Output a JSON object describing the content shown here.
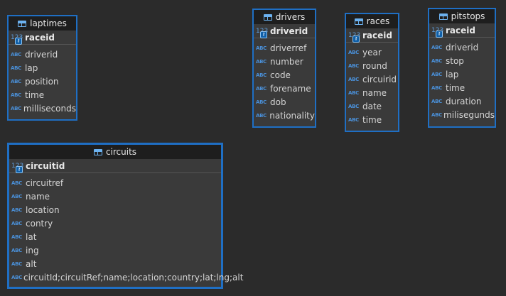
{
  "glyphs": {
    "abc": "ABC",
    "num": "123",
    "key": "⚷"
  },
  "tables": {
    "laptimes": {
      "title": "laptimes",
      "pk": "raceid",
      "fields": [
        "driverid",
        "lap",
        "position",
        "time",
        "milliseconds"
      ]
    },
    "drivers": {
      "title": "drivers",
      "pk": "driverid",
      "fields": [
        "driverref",
        "number",
        "code",
        "forename",
        "dob",
        "nationality"
      ]
    },
    "races": {
      "title": "races",
      "pk": "raceid",
      "fields": [
        "year",
        "round",
        "circuirid",
        "name",
        "date",
        "time"
      ]
    },
    "pitstops": {
      "title": "pitstops",
      "pk": "raceid",
      "fields": [
        "driverid",
        "stop",
        "lap",
        "time",
        "duration",
        "milisegunds"
      ]
    },
    "circuits": {
      "title": "circuits",
      "pk": "circuitid",
      "fields": [
        "circuitref",
        "name",
        "location",
        "contry",
        "lat",
        "ing",
        "alt",
        "circuitId;circuitRef;name;location;country;lat;lng;alt"
      ]
    }
  },
  "colors": {
    "border": "#1f6fc4",
    "header": "#1e1e1e",
    "body": "#3a3a3a",
    "canvas": "#2b2b2b"
  }
}
